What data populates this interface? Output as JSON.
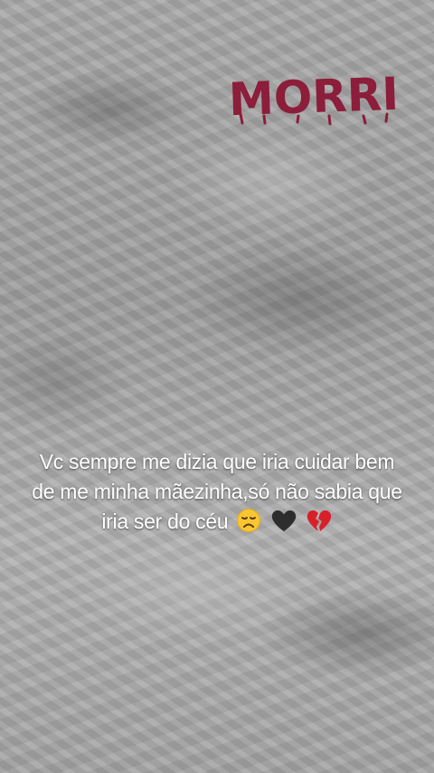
{
  "story": {
    "sticker_text": "MORRI",
    "sticker_color": "#8c1d3b",
    "caption_lines": [
      "Vc sempre me dizia que iria cuidar bem",
      "de me minha mãezinha,só não sabia que",
      "iria ser do céu"
    ],
    "emojis": [
      "disappointed-face-emoji",
      "black-heart-emoji",
      "broken-heart-emoji"
    ]
  }
}
